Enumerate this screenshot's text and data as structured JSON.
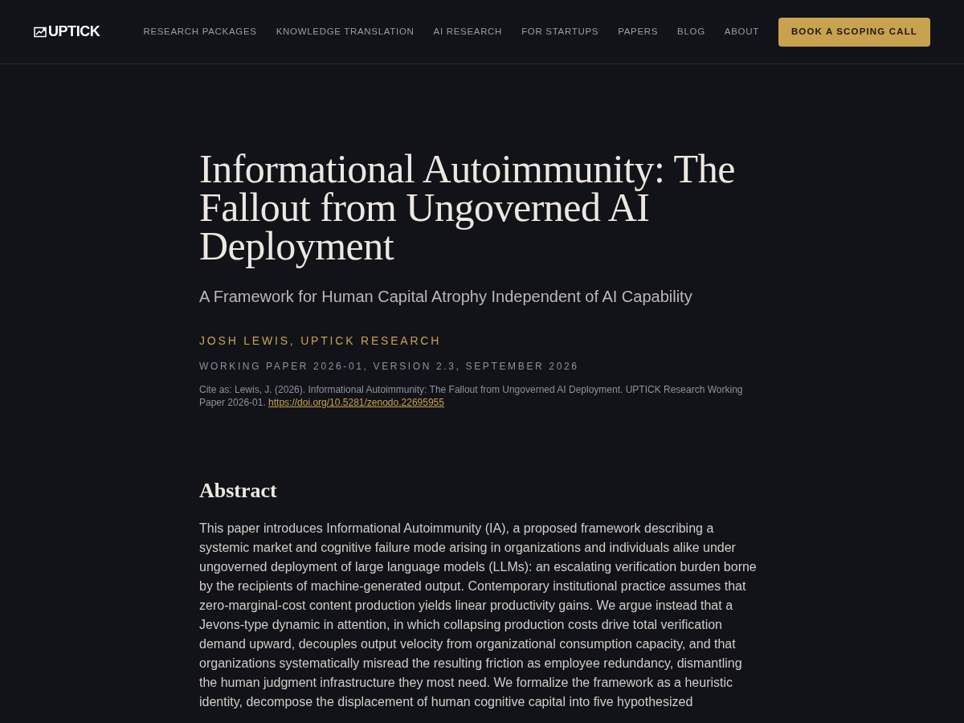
{
  "header": {
    "logo": "UPTICK",
    "nav": [
      "RESEARCH PACKAGES",
      "KNOWLEDGE TRANSLATION",
      "AI RESEARCH",
      "FOR STARTUPS",
      "PAPERS",
      "BLOG",
      "ABOUT"
    ],
    "cta": "BOOK A SCOPING CALL"
  },
  "paper": {
    "title": "Informational Autoimmunity: The Fallout from Ungoverned AI Deployment",
    "subtitle": "A Framework for Human Capital Atrophy Independent of AI Capability",
    "authors": "JOSH LEWIS, UPTICK RESEARCH",
    "meta": "WORKING PAPER 2026-01, VERSION 2.3, SEPTEMBER 2026",
    "citation": "Cite as: Lewis, J. (2026). Informational Autoimmunity: The Fallout from Ungoverned AI Deployment. UPTICK Research Working Paper 2026-01.",
    "doi": "https://doi.org/10.5281/zenodo.22695955"
  },
  "abstract": {
    "heading": "Abstract",
    "text": "This paper introduces Informational Autoimmunity (IA), a proposed framework describing a systemic market and cognitive failure mode arising in organizations and individuals alike under ungoverned deployment of large language models (LLMs): an escalating verification burden borne by the recipients of machine-generated output. Contemporary institutional practice assumes that zero-marginal-cost content production yields linear productivity gains. We argue instead that a Jevons-type dynamic in attention, in which collapsing production costs drive total verification demand upward, decouples output velocity from organizational consumption capacity, and that organizations systematically misread the resulting friction as employee redundancy, dismantling the human judgment infrastructure they most need. We formalize the framework as a heuristic identity, decompose the displacement of human cognitive capital into five hypothesized"
  }
}
